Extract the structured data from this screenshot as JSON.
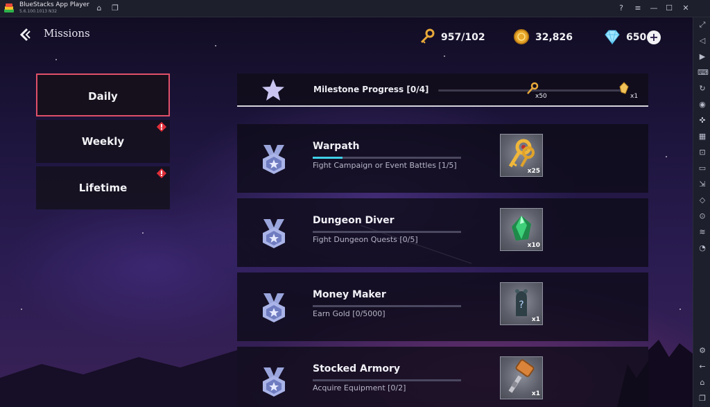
{
  "window": {
    "app_title": "BlueStacks App Player",
    "version": "5.6.100.1013  N32"
  },
  "header": {
    "title": "Missions",
    "resources": {
      "keys": "957/102",
      "gold": "32,826",
      "gems": "650"
    }
  },
  "tabs": [
    {
      "label": "Daily",
      "active": true,
      "alert": false
    },
    {
      "label": "Weekly",
      "active": false,
      "alert": true
    },
    {
      "label": "Lifetime",
      "active": false,
      "alert": true
    }
  ],
  "milestone": {
    "label": "Milestone Progress [0/4]",
    "progress": 0,
    "rewards": [
      {
        "icon": "key-icon",
        "qty": "x50"
      },
      {
        "icon": "crystal-icon",
        "qty": "x1"
      }
    ]
  },
  "missions": [
    {
      "title": "Warpath",
      "desc": "Fight Campaign or Event Battles [1/5]",
      "progress": 0.2,
      "reward_icon": "keys-icon",
      "reward_qty": "x25"
    },
    {
      "title": "Dungeon Diver",
      "desc": "Fight Dungeon Quests [0/5]",
      "progress": 0,
      "reward_icon": "green-gem-icon",
      "reward_qty": "x10"
    },
    {
      "title": "Money Maker",
      "desc": "Earn Gold [0/5000]",
      "progress": 0,
      "reward_icon": "mystery-relic-icon",
      "reward_qty": "x1"
    },
    {
      "title": "Stocked Armory",
      "desc": "Acquire Equipment [0/2]",
      "progress": 0,
      "reward_icon": "hammer-icon",
      "reward_qty": "x1"
    }
  ],
  "colors": {
    "active_tab_border": "#e0506a",
    "progress_fill": "#3fd0e8",
    "alert": "#e0303a"
  }
}
